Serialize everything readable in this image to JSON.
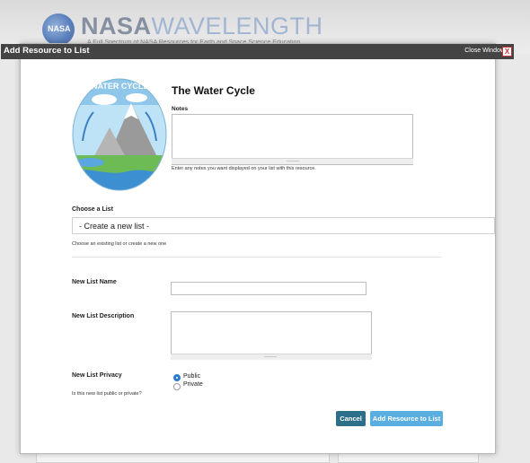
{
  "background": {
    "brand_bold": "NASA",
    "brand_light": "WAVELENGTH",
    "tagline": "A Full Spectrum of NASA Resources for Earth and Space Science Education",
    "logo_text": "NASA"
  },
  "modal": {
    "title": "Add Resource to List",
    "close_label": "Close Window",
    "close_glyph": "X"
  },
  "resource": {
    "title": "The Water Cycle",
    "thumb_label": "WATER CYCLE"
  },
  "notes": {
    "label": "Notes",
    "value": "",
    "help": "Enter any notes you want displayed on your list with this resource."
  },
  "choose_list": {
    "label": "Choose a List",
    "selected": "- Create a new list -",
    "help": "Choose an existing list or create a new one"
  },
  "new_list": {
    "name_label": "New List Name",
    "name_value": "",
    "description_label": "New List Description",
    "description_value": "",
    "privacy_label": "New List Privacy",
    "privacy_help": "Is this new list public or private?",
    "privacy_options": [
      "Public",
      "Private"
    ],
    "privacy_selected": "Public"
  },
  "buttons": {
    "cancel": "Cancel",
    "add": "Add Resource to List"
  },
  "colors": {
    "header": "#444444",
    "cancel_button": "#2b6f89",
    "add_button": "#5aaee0",
    "radio_selected": "#2a7bd0"
  }
}
